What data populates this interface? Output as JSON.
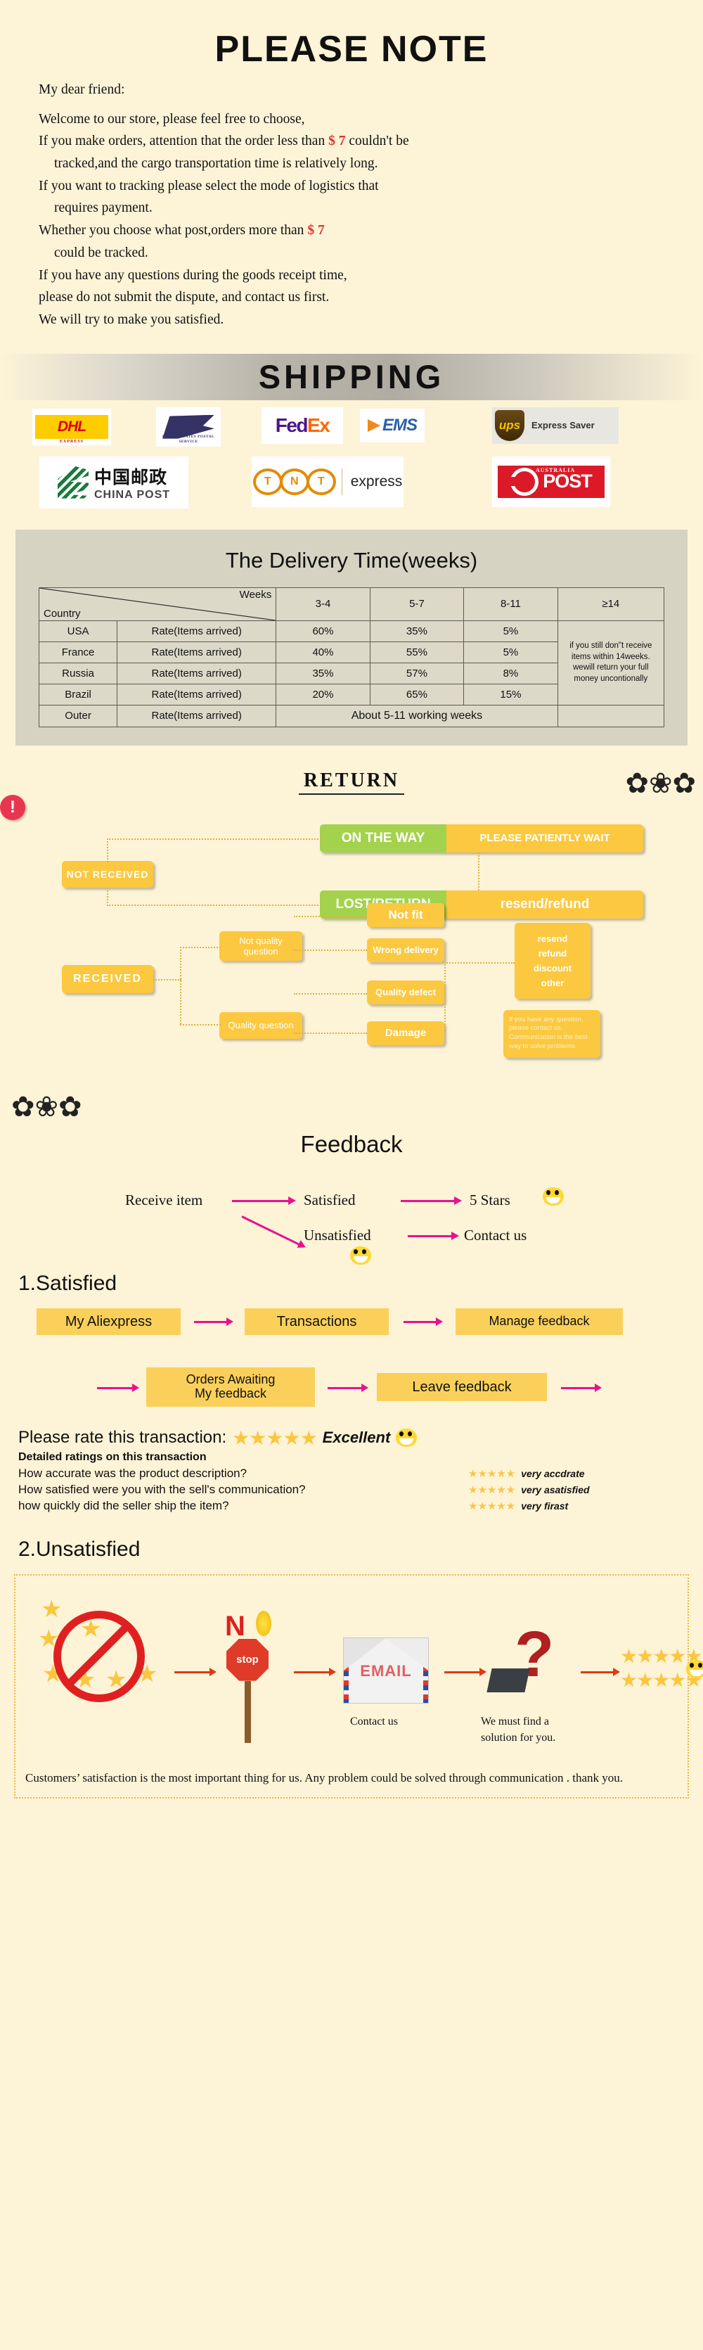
{
  "please_note": {
    "title": "PLEASE NOTE",
    "greeting": "My dear friend:",
    "lines": [
      "Welcome to our store, please feel free to choose,",
      "If you make orders, attention that the order less than",
      "tracked,and the cargo transportation time is relatively long.",
      "If you want to tracking please select the mode of logistics that",
      "requires payment.",
      "Whether you choose what post,orders more than",
      "could be tracked.",
      "If you have any questions during the goods receipt time,",
      "please do not submit the dispute, and contact us first.",
      "We will try to make you satisfied."
    ],
    "amount_1": "$ 7",
    "amount_1_tail": "couldn't be",
    "amount_2": "$ 7"
  },
  "shipping": {
    "banner": "SHIPPING",
    "carriers": [
      {
        "name": "dhl-logo",
        "text": "DHL",
        "sub": "EXPRESS"
      },
      {
        "name": "usps-logo",
        "text": "UNITED STATES POSTAL SERVICE"
      },
      {
        "name": "fedex-logo",
        "text_a": "Fed",
        "text_b": "Ex"
      },
      {
        "name": "ems-logo",
        "text": "EMS"
      },
      {
        "name": "ups-logo",
        "text": "ups",
        "sub": "Express Saver"
      },
      {
        "name": "china-post-logo",
        "cn": "中国邮政",
        "en": "CHINA POST"
      },
      {
        "name": "tnt-logo",
        "text": "TNT",
        "sub": "express"
      },
      {
        "name": "australia-post-logo",
        "text": "POST",
        "sub": "AUSTRALIA"
      }
    ]
  },
  "delivery": {
    "title": "The Delivery Time(weeks)",
    "corner_top": "Weeks",
    "corner_bottom": "Country",
    "week_headers": [
      "3-4",
      "5-7",
      "8-11",
      "≥14"
    ],
    "rate_label": "Rate(Items arrived)",
    "rows": [
      {
        "country": "USA",
        "rate": "Rate(Items arrived)",
        "values": [
          "60%",
          "35%",
          "5%"
        ]
      },
      {
        "country": "France",
        "rate": "Rate(Items arrived)",
        "values": [
          "40%",
          "55%",
          "5%"
        ]
      },
      {
        "country": "Russia",
        "rate": "Rate(Items arrived)",
        "values": [
          "35%",
          "57%",
          "8%"
        ]
      },
      {
        "country": "Brazil",
        "rate": "Rate(Items arrived)",
        "values": [
          "20%",
          "65%",
          "15%"
        ]
      }
    ],
    "outer_row": {
      "country": "Outer",
      "rate": "Rate(Items arrived)",
      "span_text": "About 5-11 working weeks"
    },
    "note": "if you still don\"t receive items within 14weeks. wewill return your full money uncontionally"
  },
  "return": {
    "title": "RETURN",
    "not_received": "NOT RECEIVED",
    "received": "RECEIVED",
    "on_the_way_left": "ON THE WAY",
    "on_the_way_right": "PLEASE PATIENTLY WAIT",
    "lost_left": "LOST/RETURN",
    "lost_right": "resend/refund",
    "not_quality": "Not quality question",
    "quality_question": "Quality question",
    "not_fit": "Not fit",
    "wrong_delivery": "Wrong delivery",
    "quality_defect": "Quality defect",
    "damage": "Damage",
    "outcomes": [
      "resend",
      "refund",
      "discount",
      "other"
    ],
    "callout": "If you have any question, please contact us. Communication is the best way to solve problems."
  },
  "feedback": {
    "title": "Feedback",
    "receive_item": "Receive item",
    "satisfied": "Satisfied",
    "five_stars": "5 Stars",
    "unsatisfied": "Unsatisfied",
    "contact_us": "Contact us"
  },
  "satisfied": {
    "heading": "1.Satisfied",
    "row1": [
      "My Aliexpress",
      "Transactions",
      "Manage feedback"
    ],
    "row2_a": "Orders Awaiting",
    "row2_b": "My feedback",
    "row2_c": "Leave feedback"
  },
  "rating": {
    "prompt": "Please rate this transaction:",
    "stars": "★★★★★",
    "excellent": "Excellent",
    "sub": "Detailed ratings on this transaction",
    "rows": [
      {
        "question": "How accurate was the product description?",
        "stars": "★★★★★",
        "label": "very accdrate"
      },
      {
        "question": "How satisfied were you with the sell's communication?",
        "stars": "★★★★★",
        "label": "very asatisfied"
      },
      {
        "question": "how quickly did the seller ship the item?",
        "stars": "★★★★★",
        "label": "very firast"
      }
    ]
  },
  "unsatisfied": {
    "heading": "2.Unsatisfied",
    "no_letter": "N",
    "stop": "stop",
    "email": "EMAIL",
    "question_mark": "?",
    "caption_contact": "Contact us",
    "caption_solution": "We must find a solution for you.",
    "footer": "Customers’ satisfaction is the most important thing for us. Any problem could be solved through communication . thank you."
  },
  "colors": {
    "page_bg": "#fdf3d7",
    "yellow": "#fbc83f",
    "green": "#a3d24c",
    "pink": "#e8118f",
    "red": "#e03a12",
    "table_bg": "#d7d3c3",
    "star": "#fbc63f"
  }
}
